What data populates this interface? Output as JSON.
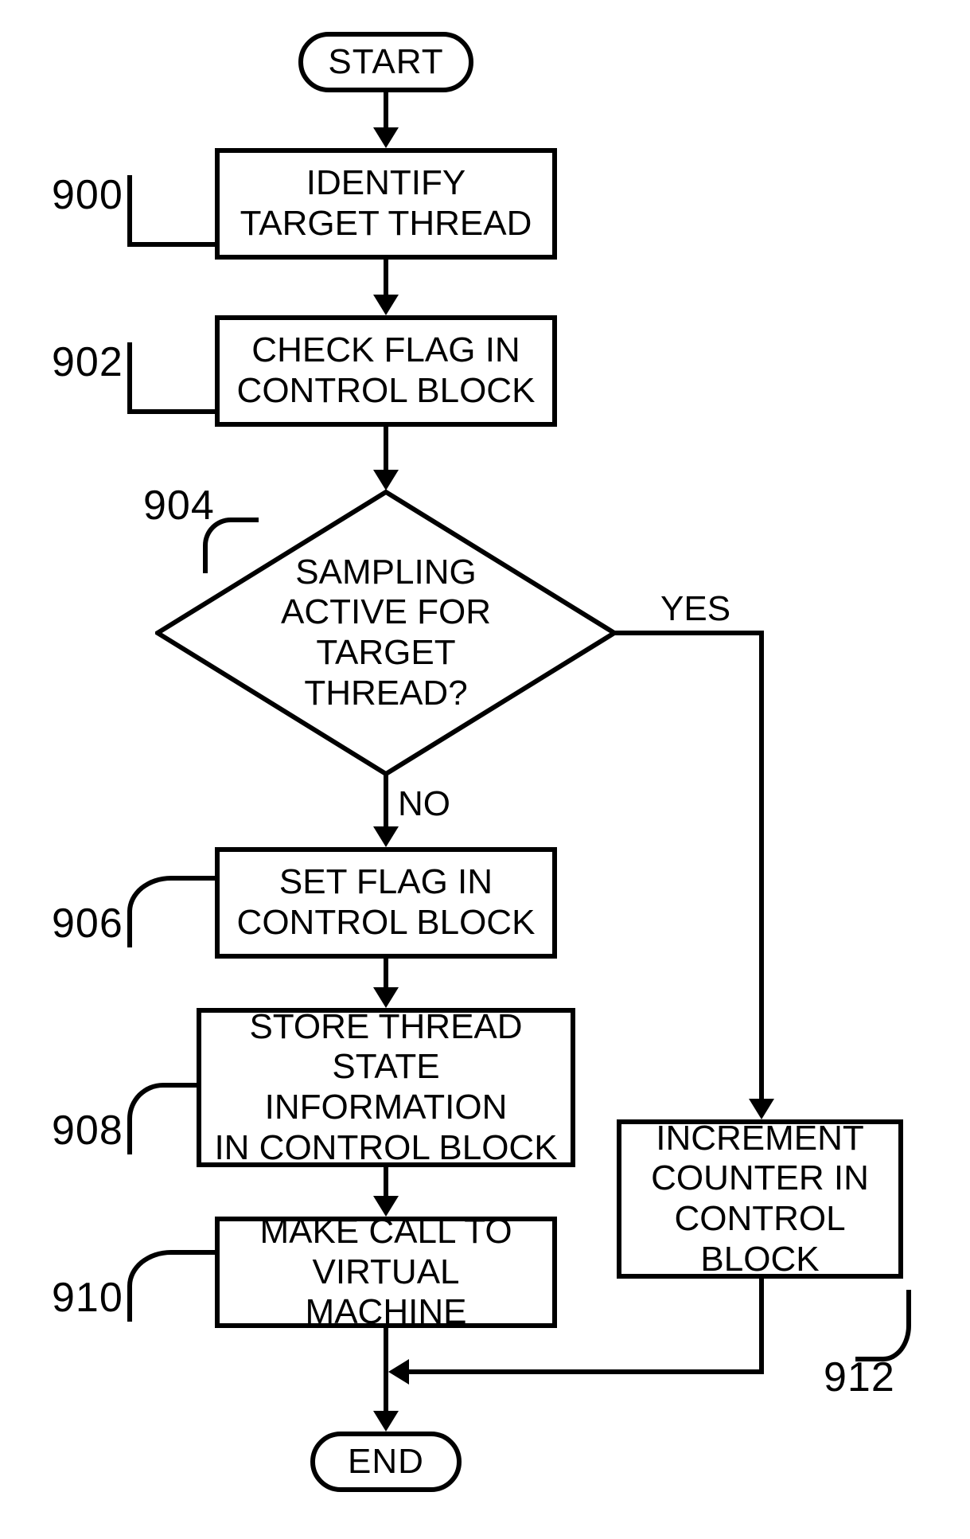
{
  "terminals": {
    "start": "START",
    "end": "END"
  },
  "processes": {
    "identify_target_thread": "IDENTIFY\nTARGET THREAD",
    "check_flag": "CHECK FLAG IN\nCONTROL BLOCK",
    "set_flag": "SET FLAG IN\nCONTROL BLOCK",
    "store_thread_state": "STORE THREAD\nSTATE INFORMATION\nIN CONTROL BLOCK",
    "make_call_vm": "MAKE CALL TO\nVIRTUAL MACHINE",
    "increment_counter": "INCREMENT\nCOUNTER IN\nCONTROL BLOCK"
  },
  "decisions": {
    "sampling_active": "SAMPLING\nACTIVE FOR TARGET\nTHREAD?"
  },
  "edge_labels": {
    "yes": "YES",
    "no": "NO"
  },
  "ref_labels": {
    "r900": "900",
    "r902": "902",
    "r904": "904",
    "r906": "906",
    "r908": "908",
    "r910": "910",
    "r912": "912"
  }
}
